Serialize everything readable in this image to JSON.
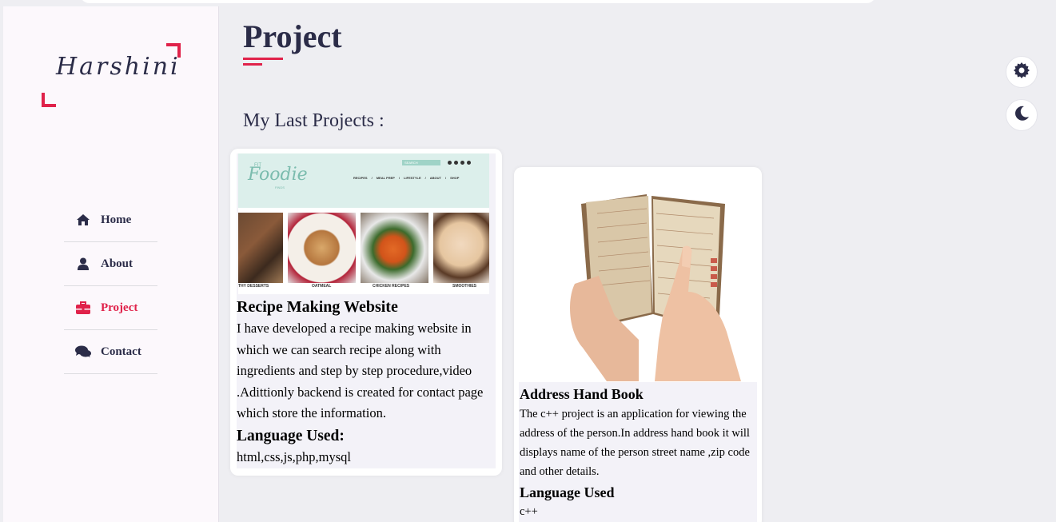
{
  "brand": {
    "logo_text": "Harshini",
    "accent": "#e0224a",
    "text_color": "#2b2c48"
  },
  "nav": [
    {
      "label": "Home",
      "icon": "home-icon",
      "active": false
    },
    {
      "label": "About",
      "icon": "user-icon",
      "active": false
    },
    {
      "label": "Project",
      "icon": "briefcase-icon",
      "active": true
    },
    {
      "label": "Contact",
      "icon": "comments-icon",
      "active": false
    }
  ],
  "page": {
    "title": "Project",
    "subtitle": "My Last Projects :"
  },
  "controls": {
    "settings_icon": "gear-icon",
    "theme_icon": "moon-icon"
  },
  "projects": [
    {
      "title": "Recipe Making Website",
      "description": "I have developed a recipe making website in which we can search recipe along with ingredients and step by step procedure,video .Adittionly backend is created for contact page which store the information.",
      "lang_heading": "Language Used:",
      "languages": "html,css,js,php,mysql",
      "thumb": {
        "brand_top": "FIT",
        "brand": "Foodie",
        "brand_bottom": "FINDS",
        "menu": [
          "RECIPES",
          "/",
          "MEAL PREP",
          "/",
          "LIFESTYLE",
          "/",
          "ABOUT",
          "/",
          "SHOP"
        ],
        "search": "SEARCH",
        "captions": [
          "THY DESSERTS",
          "OATMEAL",
          "CHICKEN RECIPES",
          "SMOOTHIES"
        ]
      }
    },
    {
      "title": "Address Hand Book",
      "description": "The c++ project is an application for viewing the address of the person.In address hand book it will displays name of the person street name ,zip code and other details.",
      "lang_heading": "Language Used",
      "languages": "c++"
    }
  ]
}
